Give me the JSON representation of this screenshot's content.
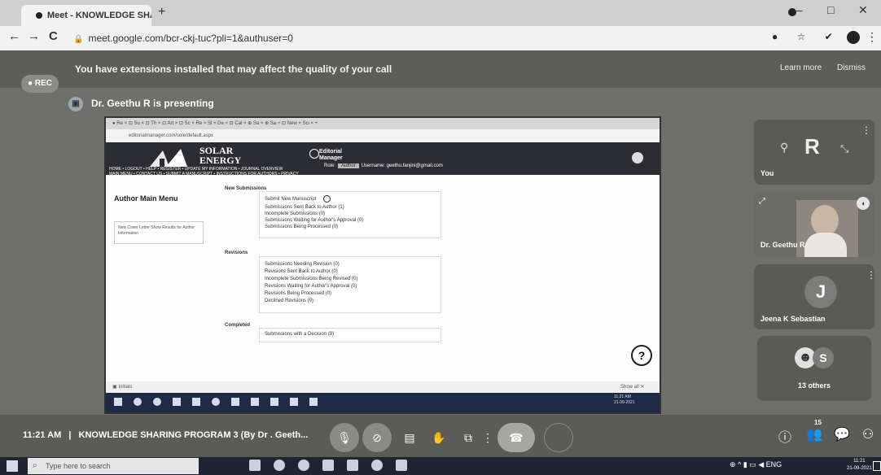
{
  "browser": {
    "tab_title": "Meet - KNOWLEDGE SHA...",
    "url": "meet.google.com/bcr-ckj-tuc?pli=1&authuser=0",
    "back": "←",
    "forward": "→",
    "reload": "C",
    "new_tab": "+",
    "win_min": "–",
    "win_max": "□",
    "win_close": "✕"
  },
  "meet": {
    "rec_label": "● REC",
    "extensions_notice": "You have extensions installed that may affect the quality of your call",
    "learn_more": "Learn more",
    "dismiss": "Dismiss",
    "presenting": "Dr. Geethu R is presenting",
    "meeting_time": "11:21 AM",
    "meeting_title": "KNOWLEDGE SHARING PROGRAM 3 (By Dr . Geeth..."
  },
  "shared_screen": {
    "tabs_text": "● Re ×   ⊡ Su ×   ⊡ Th ×   ⊡ Art ×   ⊡ Sc ×   Re ×   Sl ×   De ×   ⊡ Cal ×   ⊕ Sa ×   ⊕ Sa ×   ⊡ New ×   Sci ×   +",
    "url": "editorialmanager.com/sole/default.aspx",
    "journal_line1": "SOLAR",
    "journal_line2": "ENERGY",
    "em_logo_line1": "Editorial",
    "em_logo_line2": "Manager",
    "role_label": "Role:",
    "role_value": "Author",
    "username": "Username: geethu.fanjini@gmail.com",
    "nav_line1": "HOME • LOGOUT • HELP • REGISTER • UPDATE MY INFORMATION • JOURNAL OVERVIEW",
    "nav_line2": "MAIN MENU • CONTACT US • SUBMIT A MANUSCRIPT • INSTRUCTIONS FOR AUTHORS • PRIVACY",
    "menu_title": "Author Main Menu",
    "side_note": "New Cover Letter Show Results for Author Information",
    "new_submissions_heading": "New Submissions",
    "new_submissions": [
      "Submit New Manuscript",
      "Submissions Sent Back to Author (1)",
      "Incomplete Submissions (0)",
      "Submissions Waiting for Author's Approval (0)",
      "Submissions Being Processed (0)"
    ],
    "revisions_heading": "Revisions",
    "revisions": [
      "Submissions Needing Revision (0)",
      "Revisions Sent Back to Author (0)",
      "Incomplete Submissions Being Revised (0)",
      "Revisions Waiting for Author's Approval (0)",
      "Revisions Being Processed (0)",
      "Declined Revisions (0)"
    ],
    "completed_heading": "Completed",
    "completed": [
      "Submissions with a Decision (9)"
    ],
    "help_symbol": "?",
    "bottom_left": "▣ Initials",
    "bottom_right": "Show all  ✕",
    "clock": "11:21 AM\n21-09-2021"
  },
  "participants": {
    "you_label": "You",
    "you_initial": "R",
    "tile2_label": "Dr. Geethu R",
    "tile3_label": "Jeena K Sebastian",
    "tile3_initial": "J",
    "tile4_initial": "S",
    "others_label": "13 others"
  },
  "controls": {
    "mic": "🎙",
    "cam": "⊘",
    "cc": "▤",
    "hand": "✋",
    "present": "⧉",
    "more": "⋮",
    "end_call": "☎",
    "info": "ⓘ",
    "people": "👥",
    "people_count": "15",
    "chat": "💬",
    "activities": "⚇"
  },
  "taskbar": {
    "search_placeholder": "Type here to search",
    "time": "11:21",
    "date": "21-09-2021",
    "tray": "⊕ ^ ▮ ▭ ◀ ENG"
  }
}
